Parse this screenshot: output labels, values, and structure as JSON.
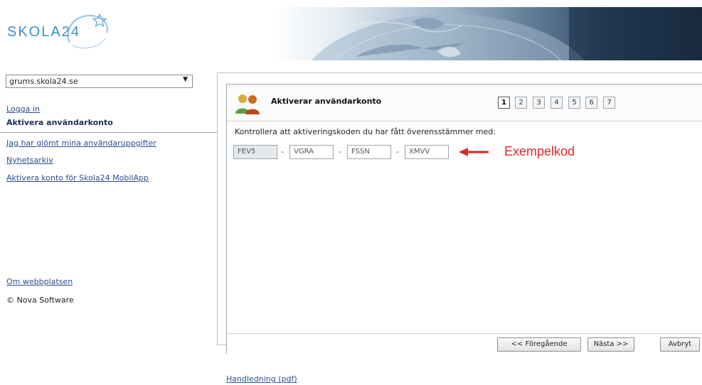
{
  "brand": {
    "logo_text": "SKOLA24"
  },
  "sidebar": {
    "site_select_value": "grums.skola24.se",
    "links": [
      {
        "label": "Logga in"
      },
      {
        "label": "Aktivera användarkonto"
      },
      {
        "label": "Jag har glömt mina användaruppgifter"
      },
      {
        "label": "Nyhetsarkiv"
      },
      {
        "label": "Aktivera konto för Skola24 MobilApp"
      }
    ],
    "about_link": "Om webbplatsen",
    "copyright": "© Nova Software"
  },
  "wizard": {
    "title": "Aktiverar användarkonto",
    "steps": [
      "1",
      "2",
      "3",
      "4",
      "5",
      "6",
      "7"
    ],
    "current_step": "1",
    "instruction": "Kontrollera att aktiveringskoden du har fått överensstämmer med:",
    "code_parts": [
      "FEV5",
      "VGRA",
      "FSSN",
      "XMVV"
    ],
    "separator": "-",
    "example_label": "Exempelkod",
    "buttons": {
      "previous": "<< Föregående",
      "next": "Nästa >>",
      "cancel": "Avbryt"
    }
  },
  "footer": {
    "manual_link": "Handledning (pdf)"
  },
  "colors": {
    "link": "#2a4c8f",
    "accent_red": "#e3232a",
    "logo_blue": "#3f8fc4",
    "banner_dark": "#1a2e45"
  },
  "icons": {
    "users": "users-icon",
    "dropdown": "dropdown-arrow-icon",
    "example_arrow": "left-arrow-icon",
    "logo_swoosh": "logo-swoosh-icon"
  }
}
